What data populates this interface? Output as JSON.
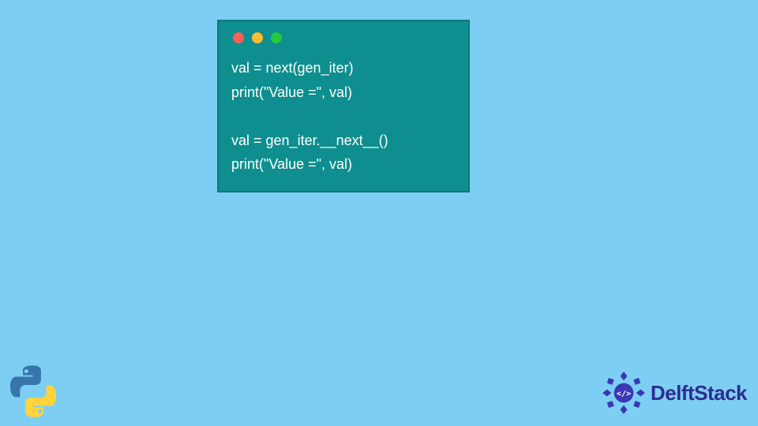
{
  "colors": {
    "bg": "#7ecef4",
    "window": "#0e8e8e",
    "red": "#ff5f57",
    "yellow": "#febc2e",
    "green": "#28c840",
    "brand_text": "#2e2b8f",
    "brand_badge": "#3b37b5"
  },
  "code": {
    "line1": "val = next(gen_iter)",
    "line2": "print(\"Value =\", val)",
    "blank": "",
    "line3": "val = gen_iter.__next__()",
    "line4": "print(\"Value =\", val)"
  },
  "brand": {
    "name": "DelftStack",
    "badge_text": "</>"
  }
}
